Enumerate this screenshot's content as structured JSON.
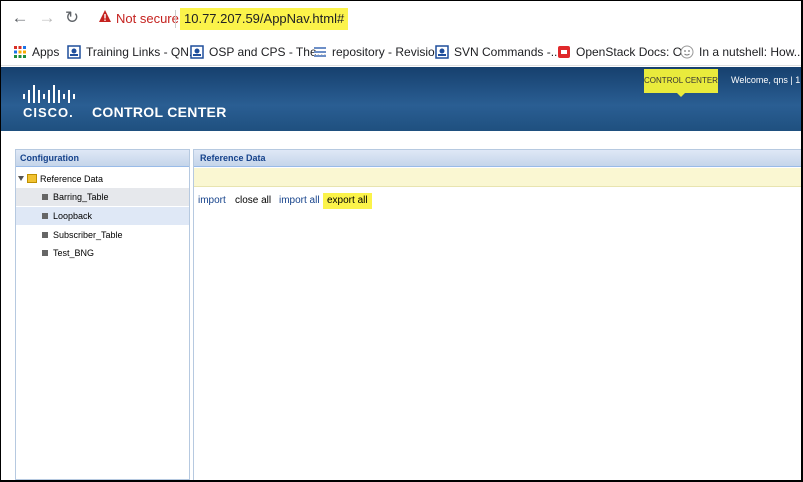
{
  "browser": {
    "back_icon": "arrow-left-icon",
    "forward_icon": "arrow-right-icon",
    "reload_icon": "reload-icon",
    "security_label": "Not secure",
    "url": "10.77.207.59/AppNav.html#"
  },
  "bookmarks": [
    {
      "label": "Apps",
      "icon": "apps-grid-icon"
    },
    {
      "label": "Training Links - QN...",
      "icon": "bookmark-page-icon"
    },
    {
      "label": "OSP and CPS - The...",
      "icon": "bookmark-page-icon"
    },
    {
      "label": "repository - Revisio...",
      "icon": "bookmark-repo-icon"
    },
    {
      "label": "SVN Commands -...",
      "icon": "bookmark-page-icon"
    },
    {
      "label": "OpenStack Docs: O...",
      "icon": "openstack-icon"
    },
    {
      "label": "In a nutshell: How...",
      "icon": "bookmark-site-icon"
    }
  ],
  "header": {
    "brand": "CISCO.",
    "title": "CONTROL CENTER",
    "control_center_link": "CONTROL CENTER",
    "welcome": "Welcome, qns  | 1"
  },
  "left_panel": {
    "title": "Configuration",
    "root": "Reference Data",
    "items": [
      "Barring_Table",
      "Loopback",
      "Subscriber_Table",
      "Test_BNG"
    ]
  },
  "right_panel": {
    "title": "Reference Data",
    "actions": {
      "import": "import",
      "close_all": "close all",
      "import_all": "import all",
      "export_all": "export all"
    }
  },
  "colors": {
    "highlight": "#fbf34a",
    "header_blue": "#2a5e93",
    "link_blue": "#15428b",
    "warning_red": "#c5221f"
  }
}
